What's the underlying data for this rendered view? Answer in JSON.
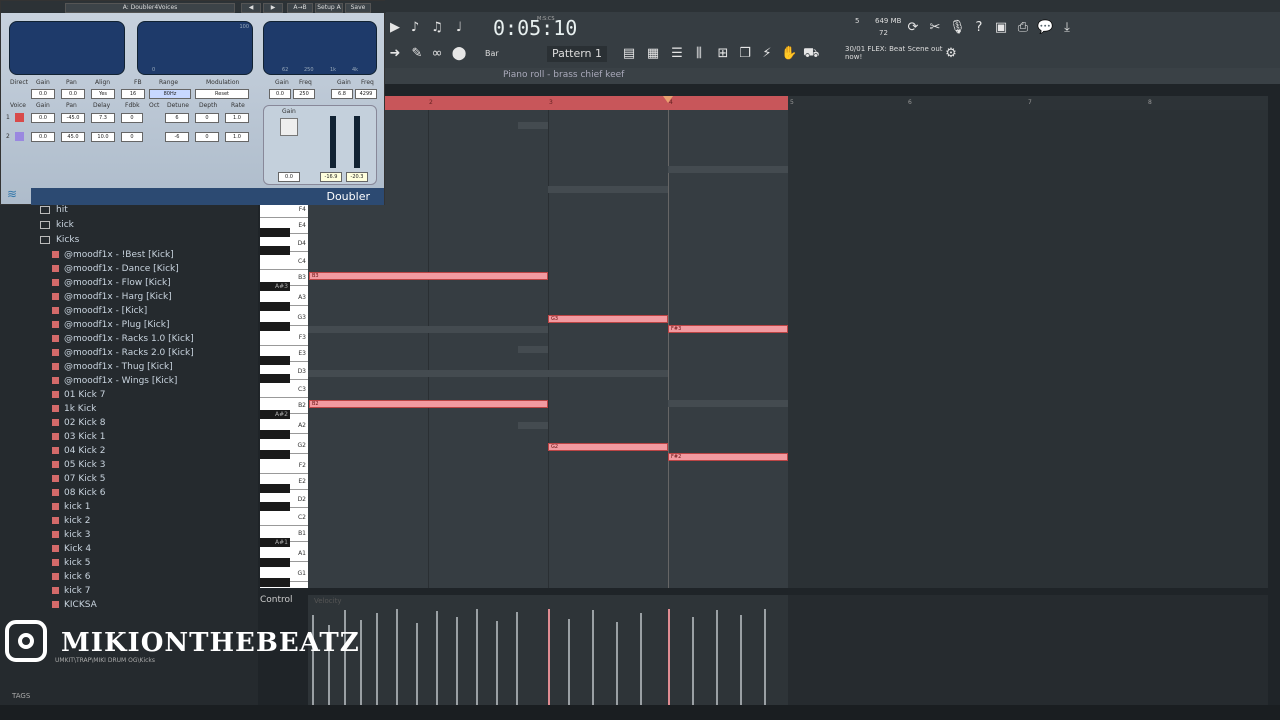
{
  "plugin": {
    "preset": "A: Doubler4Voices",
    "ab_label": "A→B",
    "setup_label": "Setup A",
    "save_label": "Save",
    "name": "Doubler",
    "headers1": [
      "Direct",
      "Gain",
      "Pan",
      "Align",
      "FB",
      "Range",
      "Modulation"
    ],
    "values1": [
      "0.0",
      "0.0",
      "Yes",
      "16",
      "80Hz",
      "Reset"
    ],
    "headers2": [
      "Voice",
      "Gain",
      "Pan",
      "Delay",
      "Fdbk",
      "Oct",
      "Detune",
      "Depth",
      "Rate"
    ],
    "voice1": [
      "1",
      "0.0",
      "-45.0",
      "7.3",
      "0",
      "6",
      "0",
      "1.0"
    ],
    "voice2": [
      "2",
      "0.0",
      "45.0",
      "10.0",
      "0",
      "-6",
      "0",
      "1.0"
    ],
    "eq_headers": [
      "Gain",
      "Freq",
      "Gain",
      "Freq"
    ],
    "eq_values": [
      "0.0",
      "250",
      "6.8",
      "4299"
    ],
    "gain_label": "Gain",
    "gain_value": "0.0",
    "meter_values": [
      "-16.9",
      "-20.3"
    ],
    "scale_labels": [
      "100",
      "60",
      "50",
      "40",
      "20",
      "0"
    ],
    "x_scale": [
      "0",
      "20",
      "40",
      "60",
      "80",
      "100"
    ],
    "eq_x": [
      "62",
      "250",
      "1k",
      "4k"
    ]
  },
  "toolbar": {
    "time": "0:05:10",
    "time_label": "M:S:CS",
    "snap": "Bar",
    "pattern": "Pattern 1",
    "memory": "649 MB",
    "voices": "72",
    "cpu": "5",
    "news": "30/01 FLEX: Beat Scene out now!"
  },
  "pianoroll": {
    "title": "Piano roll - brass chief keef",
    "ruler": [
      "2",
      "3",
      "4",
      "5",
      "6",
      "7",
      "8"
    ],
    "keys": [
      "F4",
      "E4",
      "D4",
      "C4",
      "B3",
      "A#3",
      "A3",
      "G3",
      "F3",
      "E3",
      "D3",
      "C3",
      "B2",
      "A#2",
      "A2",
      "G2",
      "F2",
      "E2",
      "D2",
      "C2",
      "B1",
      "A#1",
      "A1",
      "G1"
    ],
    "notes": [
      "B3",
      "G3",
      "F#3",
      "B2",
      "G2",
      "F#2"
    ],
    "control_label": "Control",
    "control_sub": "Velocity"
  },
  "browser": {
    "folders": [
      "hit",
      "kick",
      "Kicks"
    ],
    "items": [
      "@moodf1x - !Best [Kick]",
      "@moodf1x - Dance [Kick]",
      "@moodf1x - Flow [Kick]",
      "@moodf1x - Harg [Kick]",
      "@moodf1x - [Kick]",
      "@moodf1x - Plug [Kick]",
      "@moodf1x - Racks 1.0 [Kick]",
      "@moodf1x - Racks 2.0 [Kick]",
      "@moodf1x - Thug [Kick]",
      "@moodf1x - Wings [Kick]",
      "01 Kick 7",
      "1k Kick",
      "02 Kick 8",
      "03 Kick 1",
      "04 Kick 2",
      "05 Kick 3",
      "07 Kick 5",
      "08 Kick 6",
      "kick 1",
      "kick 2",
      "kick 3",
      "Kick 4",
      "kick 5",
      "kick 6",
      "kick 7",
      "KICKSA"
    ],
    "path": "UMKIT\\TRAP\\MIKI DRUM OG\\Kicks",
    "tags": "TAGS"
  },
  "watermark": "MIKIONTHEBEATZ"
}
